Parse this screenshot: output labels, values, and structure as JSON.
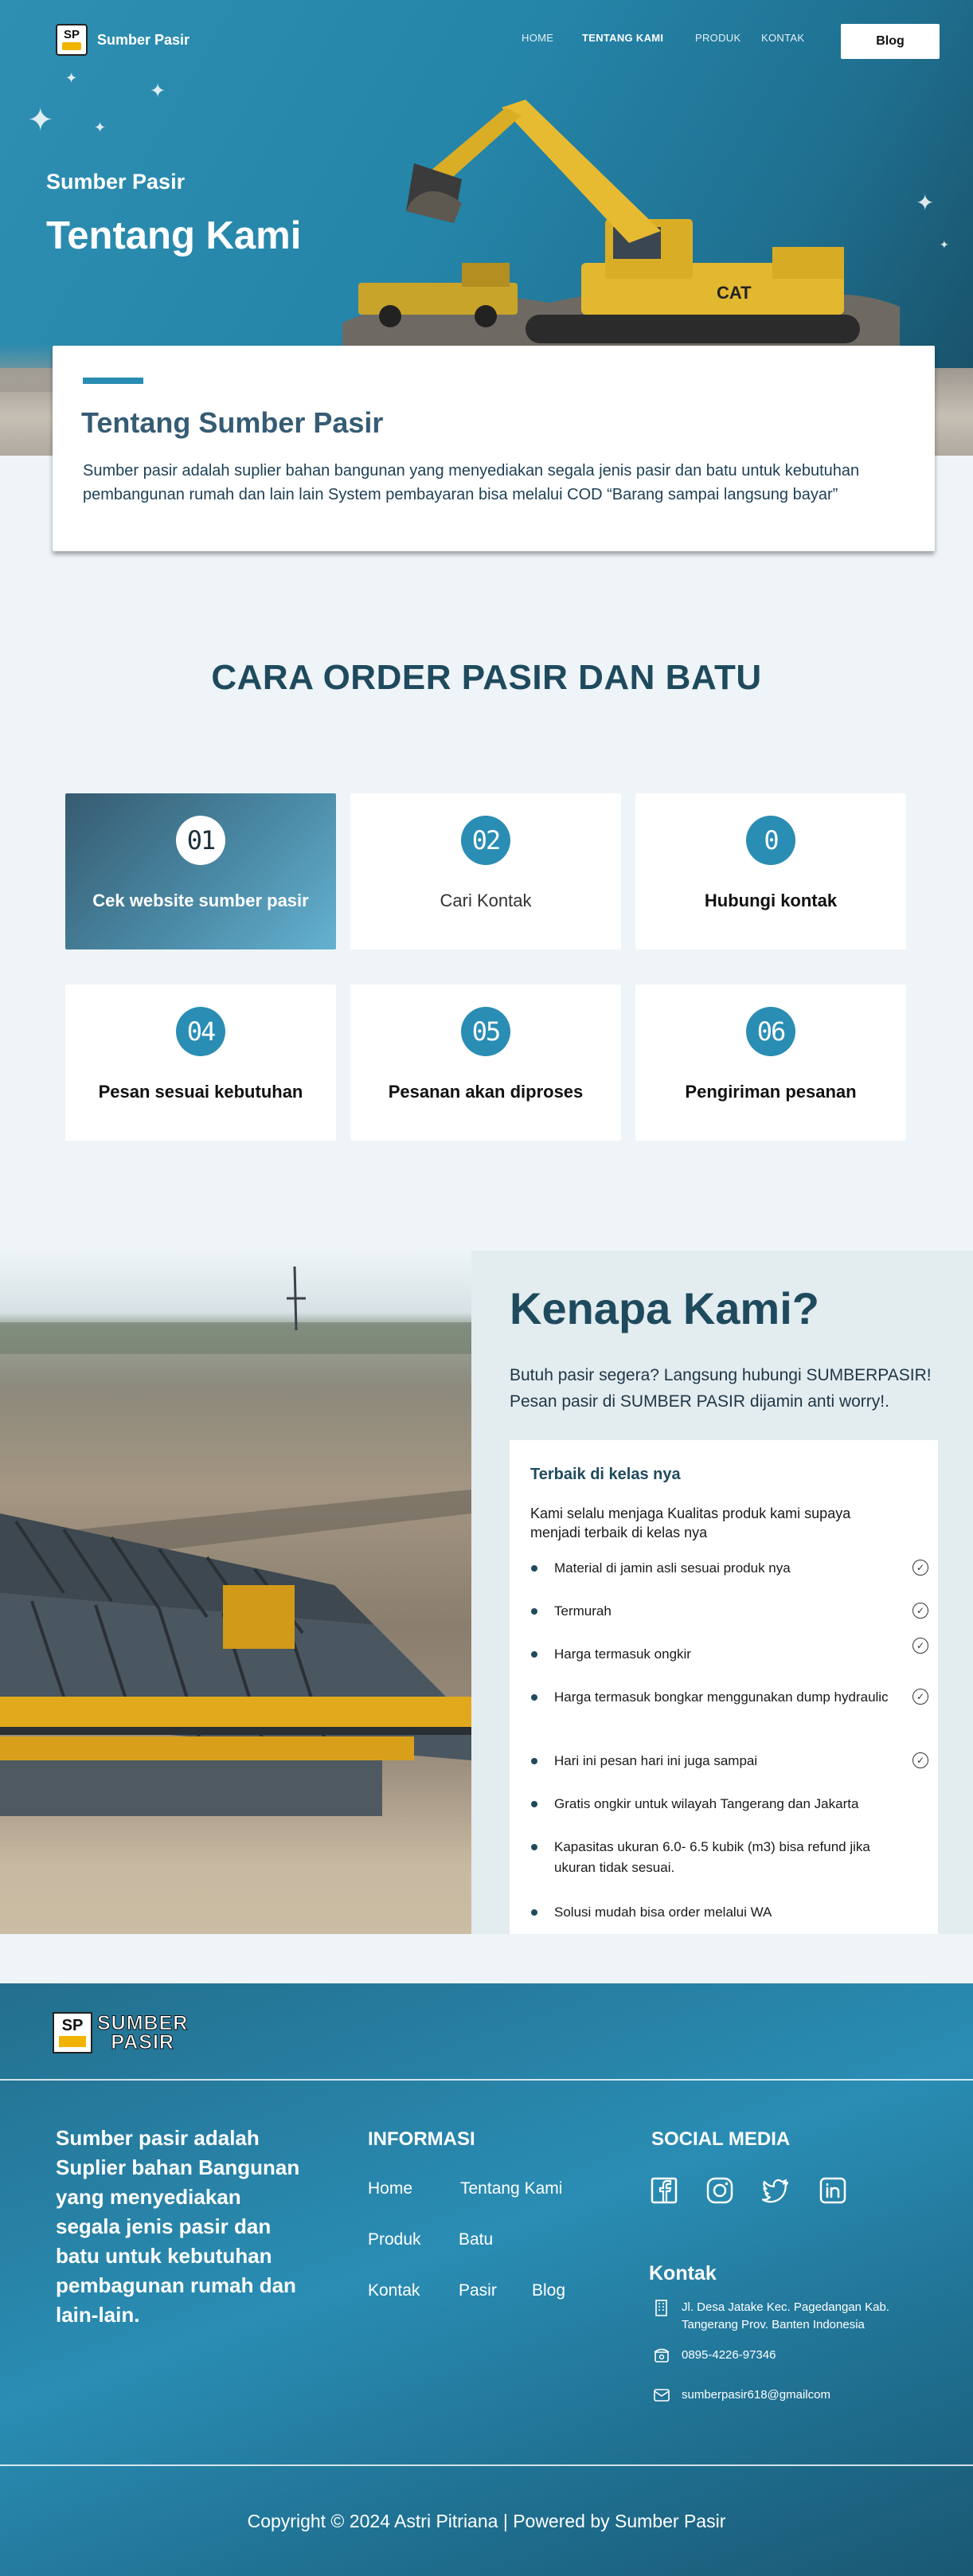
{
  "nav": {
    "brand": "Sumber Pasir",
    "logo_text": "SP",
    "links": [
      "HOME",
      "TENTANG KAMI",
      "PRODUK",
      "KONTAK"
    ],
    "blog": "Blog"
  },
  "hero": {
    "kicker": "Sumber Pasir",
    "title": "Tentang Kami"
  },
  "about": {
    "title": "Tentang Sumber Pasir",
    "text": "Sumber pasir adalah suplier bahan bangunan yang menyediakan segala jenis pasir dan batu untuk kebutuhan pembangunan rumah dan lain lain System pembayaran bisa melalui COD “Barang sampai langsung bayar”"
  },
  "order": {
    "title": "CARA ORDER PASIR DAN BATU",
    "steps": [
      {
        "num": "01",
        "label": "Cek website sumber pasir"
      },
      {
        "num": "02",
        "label": "Cari Kontak"
      },
      {
        "num": "0",
        "label": "Hubungi kontak"
      },
      {
        "num": "04",
        "label": "Pesan sesuai kebutuhan"
      },
      {
        "num": "05",
        "label": "Pesanan akan diproses"
      },
      {
        "num": "06",
        "label": "Pengiriman pesanan"
      }
    ]
  },
  "why": {
    "title": "Kenapa Kami?",
    "subtitle": "Butuh pasir segera? Langsung hubungi SUMBERPASIR! Pesan pasir di SUMBER PASIR dijamin anti worry!.",
    "card_title": "Terbaik di kelas nya",
    "card_desc": "Kami selalu menjaga Kualitas produk kami supaya menjadi terbaik di kelas nya",
    "items": [
      "Material di jamin asli sesuai produk nya",
      "Termurah",
      "Harga termasuk ongkir",
      "Harga termasuk bongkar menggunakan dump hydraulic",
      "Hari ini pesan hari ini juga sampai",
      "Gratis ongkir untuk wilayah Tangerang dan Jakarta",
      "Kapasitas ukuran 6.0- 6.5 kubik (m3) bisa refund jika ukuran tidak sesuai.",
      "Solusi mudah bisa order melalui WA"
    ]
  },
  "footer": {
    "logo_line1": "SUMBER",
    "logo_line2": "PASIR",
    "about": "Sumber pasir adalah Suplier bahan Bangunan yang menyediakan segala jenis pasir dan batu untuk kebutuhan pembagunan rumah dan lain-lain.",
    "info_title": "INFORMASI",
    "info_links": [
      "Home",
      "Tentang Kami",
      "Produk",
      "Batu",
      "Kontak",
      "Pasir",
      "Blog"
    ],
    "social_title": "SOCIAL MEDIA",
    "social_icons": [
      "facebook-icon",
      "instagram-icon",
      "twitter-icon",
      "linkedin-icon"
    ],
    "contact_title": "Kontak",
    "address": "Jl. Desa Jatake Kec. Pagedangan Kab. Tangerang Prov. Banten Indonesia",
    "phone": "0895-4226-97346",
    "email": "sumberpasir618@gmailcom",
    "copyright": "Copyright © 2024 Astri Pitriana | Powered by Sumber Pasir"
  },
  "colors": {
    "primary": "#2a8db4",
    "dark_heading": "#1f4a5e",
    "page_bg": "#eef4f7"
  }
}
